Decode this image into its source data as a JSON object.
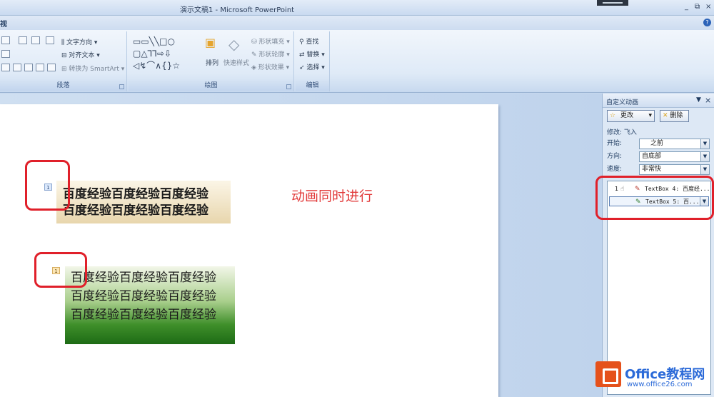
{
  "window": {
    "title": "演示文稿1 - Microsoft PowerPoint",
    "controls": [
      "_",
      "⧉",
      "×"
    ]
  },
  "tabs": {
    "partial_tab": "视",
    "help": "?"
  },
  "ribbon": {
    "paragraph": {
      "label": "段落",
      "text_direction": "文字方向",
      "align_text": "对齐文本",
      "convert_smartart": "转换为 SmartArt"
    },
    "drawing": {
      "label": "绘图",
      "arrange": "排列",
      "quick_styles": "快速样式",
      "shape_fill": "形状填充",
      "shape_outline": "形状轮廓",
      "shape_effects": "形状效果"
    },
    "editing": {
      "label": "编辑",
      "find": "查找",
      "replace": "替换",
      "select": "选择"
    }
  },
  "slide": {
    "tag1": "1",
    "tag2": "1",
    "textbox1_lines": [
      "百度经验百度经验百度经验",
      "百度经验百度经验百度经验"
    ],
    "textbox2_lines": [
      "百度经验百度经验百度经验",
      "百度经验百度经验百度经验",
      "百度经验百度经验百度经验"
    ],
    "note": "动画同时进行",
    "colors": {
      "note": "#e23d3d",
      "highlight": "#e0202a"
    }
  },
  "taskpane": {
    "title": "自定义动画",
    "change_button": "更改",
    "delete_button": "删除",
    "modify_label": "修改: 飞入",
    "start_label": "开始:",
    "start_value": "之前",
    "direction_label": "方向:",
    "direction_value": "自底部",
    "speed_label": "速度:",
    "speed_value": "非常快",
    "items": [
      {
        "num": "1",
        "label": "TextBox 4: 百度经..."
      },
      {
        "num": "",
        "label": "TextBox 5: 百..."
      }
    ]
  },
  "watermark": {
    "title": "Office教程网",
    "url": "www.office26.com"
  }
}
